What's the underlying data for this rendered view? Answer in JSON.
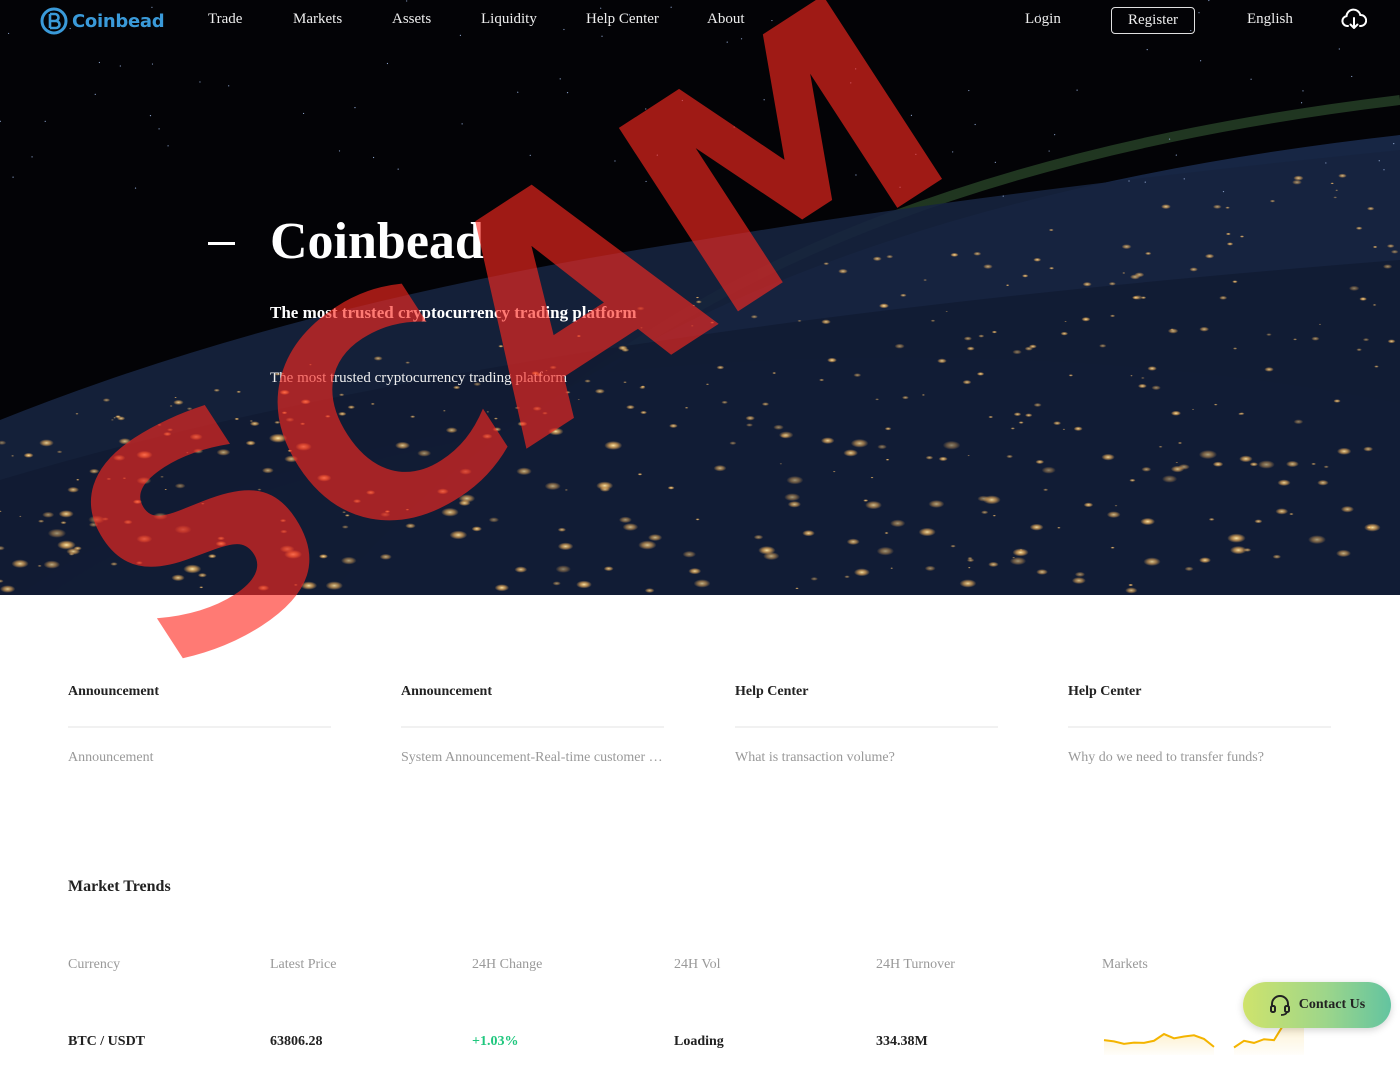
{
  "nav": {
    "brand": "Coinbead",
    "links": [
      {
        "label": "Trade"
      },
      {
        "label": "Markets"
      },
      {
        "label": "Assets"
      },
      {
        "label": "Liquidity"
      },
      {
        "label": "Help Center"
      },
      {
        "label": "About"
      }
    ],
    "login_label": "Login",
    "register_label": "Register",
    "language_label": "English",
    "download_icon": "cloud-download-icon"
  },
  "hero": {
    "title": "Coinbead",
    "subtitle": "The most trusted cryptocurrency trading platform",
    "description": "The most trusted cryptocurrency trading platform"
  },
  "notices": [
    {
      "title": "Announcement",
      "item": "Announcement"
    },
    {
      "title": "Announcement",
      "item": "System Announcement-Real-time customer service"
    },
    {
      "title": "Help Center",
      "item": "What is transaction volume?"
    },
    {
      "title": "Help Center",
      "item": "Why do we need to transfer funds?"
    }
  ],
  "market": {
    "title": "Market Trends",
    "columns": [
      "Currency",
      "Latest Price",
      "24H Change",
      "24H Vol",
      "24H Turnover",
      "Markets"
    ],
    "rows": [
      {
        "currency": "BTC / USDT",
        "price": "63806.28",
        "change": "+1.03%",
        "volume": "Loading",
        "turnover": "334.38M",
        "sparkline": [
          0.42,
          0.38,
          0.3,
          0.34,
          0.33,
          0.4,
          0.62,
          0.48,
          0.54,
          0.58,
          0.46,
          0.2,
          null,
          0.18,
          0.4,
          0.33,
          0.45,
          0.42,
          0.95,
          0.88,
          1.0
        ]
      }
    ],
    "colors": {
      "up": "#1fc77e",
      "sparkline": "#f4b400"
    }
  },
  "contact": {
    "label": "Contact Us",
    "icon": "headset-icon"
  },
  "watermark": {
    "text": "SCAM",
    "color": "#ff2a1e"
  }
}
